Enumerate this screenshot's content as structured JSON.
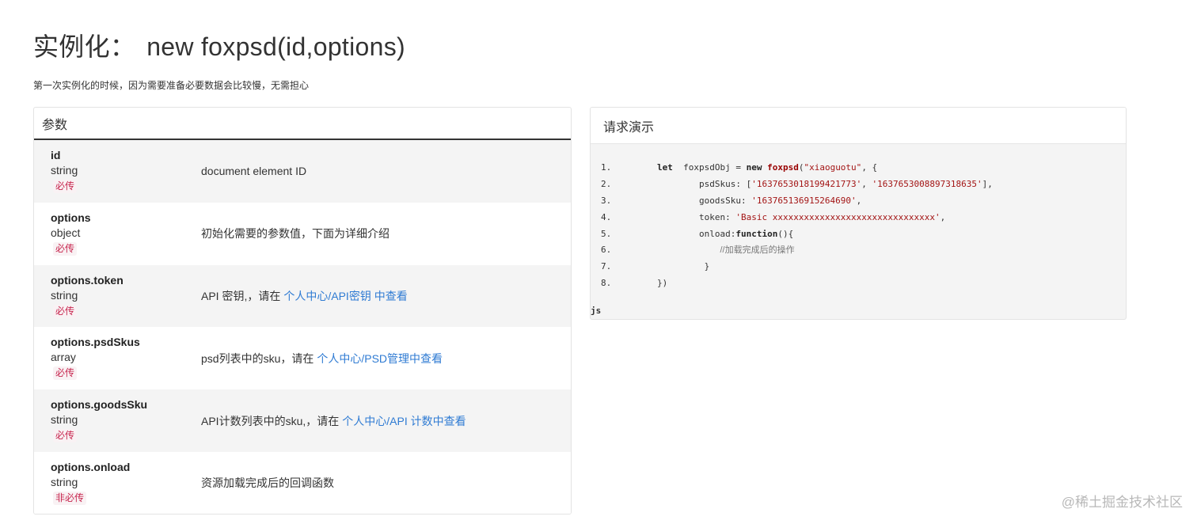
{
  "title": {
    "prefix": "实例化：",
    "code": "new foxpsd(id,options)"
  },
  "subtitle": "第一次实例化的时候，因为需要准备必要数据会比较慢，无需担心",
  "params": {
    "header": "参数",
    "rows": [
      {
        "name": "id",
        "type": "string",
        "required": "必传",
        "desc": "document element ID",
        "link": ""
      },
      {
        "name": "options",
        "type": "object",
        "required": "必传",
        "desc": "初始化需要的参数值，下面为详细介绍",
        "link": ""
      },
      {
        "name": "options.token",
        "type": "string",
        "required": "必传",
        "desc": "API 密钥,，请在",
        "link": "个人中心/API密钥 中查看"
      },
      {
        "name": "options.psdSkus",
        "type": "array",
        "required": "必传",
        "desc": "psd列表中的sku，请在",
        "link": "个人中心/PSD管理中查看"
      },
      {
        "name": "options.goodsSku",
        "type": "string",
        "required": "必传",
        "desc": "API计数列表中的sku,，请在",
        "link": "个人中心/API 计数中查看"
      },
      {
        "name": "options.onload",
        "type": "string",
        "required": "非必传",
        "desc": "资源加载完成后的回调函数",
        "link": ""
      }
    ]
  },
  "demo": {
    "header": "请求演示",
    "language": "js",
    "lines": [
      {
        "no": "1.",
        "indent": "",
        "tokens": [
          [
            "kw",
            "let"
          ],
          [
            "",
            "  foxpsdObj = "
          ],
          [
            "kw",
            "new"
          ],
          [
            "",
            ""
          ],
          [
            "fn",
            " foxpsd"
          ],
          [
            "",
            "("
          ],
          [
            "str",
            "\"xiaoguotu\""
          ],
          [
            "",
            ", {"
          ]
        ]
      },
      {
        "no": "2.",
        "indent": "        ",
        "tokens": [
          [
            "",
            "psdSkus: ["
          ],
          [
            "str",
            "'1637653018199421773'"
          ],
          [
            "",
            ", "
          ],
          [
            "str",
            "'1637653008897318635'"
          ],
          [
            "",
            "],"
          ]
        ]
      },
      {
        "no": "3.",
        "indent": "        ",
        "tokens": [
          [
            "",
            "goodsSku: "
          ],
          [
            "str",
            "'163765136915264690'"
          ],
          [
            "",
            ","
          ]
        ]
      },
      {
        "no": "4.",
        "indent": "        ",
        "tokens": [
          [
            "",
            "token: "
          ],
          [
            "str",
            "'Basic xxxxxxxxxxxxxxxxxxxxxxxxxxxxxxx'"
          ],
          [
            "",
            ","
          ]
        ]
      },
      {
        "no": "5.",
        "indent": "        ",
        "tokens": [
          [
            "",
            "onload:"
          ],
          [
            "kw",
            "function"
          ],
          [
            "",
            "(){"
          ]
        ]
      },
      {
        "no": "6.",
        "indent": "            ",
        "tokens": [
          [
            "cmt",
            "//加载完成后的操作"
          ]
        ]
      },
      {
        "no": "7.",
        "indent": "         ",
        "tokens": [
          [
            "",
            "}"
          ]
        ]
      },
      {
        "no": "8.",
        "indent": "",
        "tokens": [
          [
            "",
            "})"
          ]
        ]
      }
    ]
  },
  "watermark": "@稀土掘金技术社区"
}
